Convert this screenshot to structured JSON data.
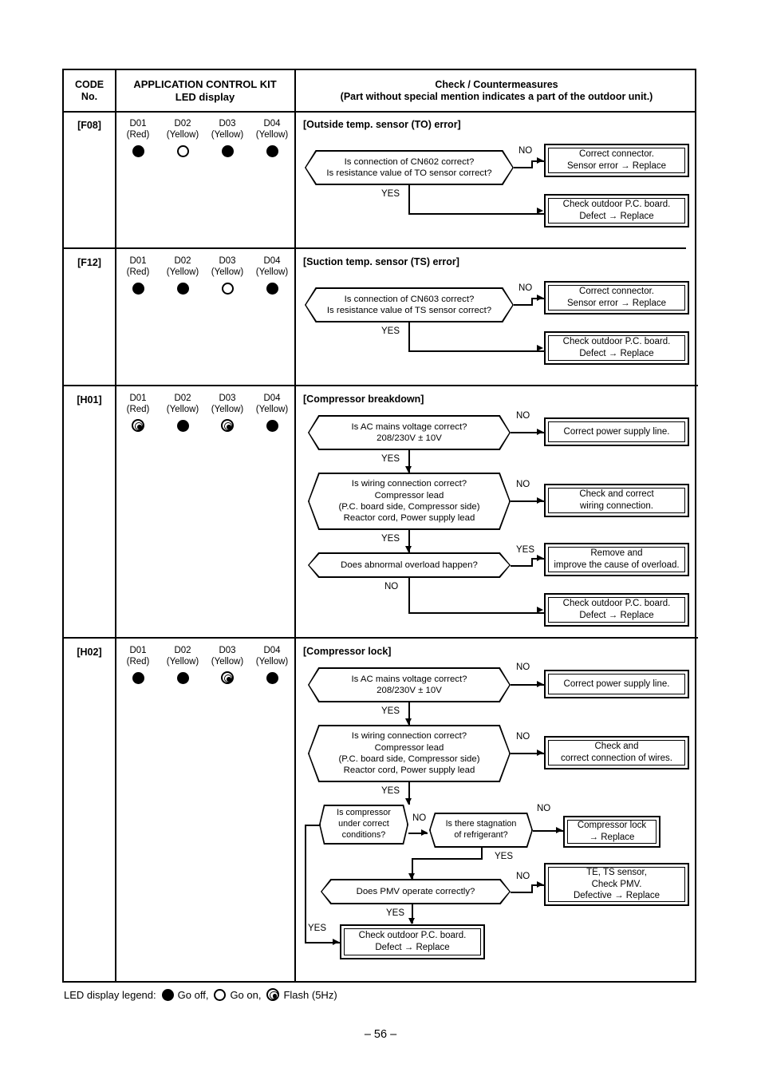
{
  "page": {
    "folio": "– 56 –",
    "legend": {
      "prefix": "LED display legend:",
      "off": "Go off,",
      "on": "Go on,",
      "flash": "Flash (5Hz)"
    }
  },
  "table": {
    "header": {
      "code_line1": "CODE",
      "code_line2": "No.",
      "led_line1": "APPLICATION CONTROL KIT",
      "led_line2": "LED display",
      "check_line1": "Check / Countermeasures",
      "check_line2": "(Part without special mention indicates a part of the outdoor unit.)"
    },
    "rows": [
      {
        "code": "[F08]",
        "leds": [
          {
            "name": "D01",
            "color": "(Red)",
            "state": "off"
          },
          {
            "name": "D02",
            "color": "(Yellow)",
            "state": "on"
          },
          {
            "name": "D03",
            "color": "(Yellow)",
            "state": "off"
          },
          {
            "name": "D04",
            "color": "(Yellow)",
            "state": "off"
          }
        ],
        "title": "[Outside temp. sensor (TO) error]",
        "decisions": [
          {
            "line1": "Is connection of CN602 correct?",
            "line2": "Is resistance value of TO sensor correct?"
          }
        ],
        "results": [
          {
            "line1": "Correct connector.",
            "line2": "Sensor error → Replace"
          },
          {
            "line1": "Check outdoor P.C. board.",
            "line2": "Defect → Replace"
          }
        ],
        "labels": {
          "no": "NO",
          "yes": "YES"
        }
      },
      {
        "code": "[F12]",
        "leds": [
          {
            "name": "D01",
            "color": "(Red)",
            "state": "off"
          },
          {
            "name": "D02",
            "color": "(Yellow)",
            "state": "off"
          },
          {
            "name": "D03",
            "color": "(Yellow)",
            "state": "on"
          },
          {
            "name": "D04",
            "color": "(Yellow)",
            "state": "off"
          }
        ],
        "title": "[Suction temp. sensor (TS) error]",
        "decisions": [
          {
            "line1": "Is connection of CN603 correct?",
            "line2": "Is resistance value of TS sensor correct?"
          }
        ],
        "results": [
          {
            "line1": "Correct connector.",
            "line2": "Sensor error → Replace"
          },
          {
            "line1": "Check outdoor P.C. board.",
            "line2": "Defect → Replace"
          }
        ],
        "labels": {
          "no": "NO",
          "yes": "YES"
        }
      },
      {
        "code": "[H01]",
        "leds": [
          {
            "name": "D01",
            "color": "(Red)",
            "state": "flash"
          },
          {
            "name": "D02",
            "color": "(Yellow)",
            "state": "off"
          },
          {
            "name": "D03",
            "color": "(Yellow)",
            "state": "flash"
          },
          {
            "name": "D04",
            "color": "(Yellow)",
            "state": "off"
          }
        ],
        "title": "[Compressor breakdown]",
        "decisions": [
          {
            "line1": "Is AC mains voltage correct?",
            "line2": "208/230V ± 10V"
          },
          {
            "line1": "Is wiring connection correct?",
            "line2": "Compressor lead",
            "line3": "(P.C. board side, Compressor side)",
            "line4": "Reactor cord, Power supply lead"
          },
          {
            "line1": "Does abnormal overload happen?"
          }
        ],
        "results": [
          {
            "line1": "Correct power supply line."
          },
          {
            "line1": "Check and correct",
            "line2": "wiring connection."
          },
          {
            "line1": "Remove and",
            "line2": "improve the cause of overload."
          },
          {
            "line1": "Check outdoor P.C. board.",
            "line2": "Defect → Replace"
          }
        ],
        "labels": {
          "no": "NO",
          "yes": "YES"
        }
      },
      {
        "code": "[H02]",
        "leds": [
          {
            "name": "D01",
            "color": "(Red)",
            "state": "off"
          },
          {
            "name": "D02",
            "color": "(Yellow)",
            "state": "off"
          },
          {
            "name": "D03",
            "color": "(Yellow)",
            "state": "flash"
          },
          {
            "name": "D04",
            "color": "(Yellow)",
            "state": "off"
          }
        ],
        "title": "[Compressor lock]",
        "decisions": [
          {
            "line1": "Is AC mains voltage correct?",
            "line2": "208/230V ± 10V"
          },
          {
            "line1": "Is wiring connection correct?",
            "line2": "Compressor lead",
            "line3": "(P.C. board side, Compressor side)",
            "line4": "Reactor cord, Power supply lead"
          },
          {
            "line1": "Is compressor",
            "line2": "under correct",
            "line3": "conditions?"
          },
          {
            "line1": "Is there stagnation",
            "line2": "of refrigerant?"
          },
          {
            "line1": "Does PMV operate correctly?"
          }
        ],
        "results": [
          {
            "line1": "Correct power supply line."
          },
          {
            "line1": "Check and",
            "line2": "correct connection of wires."
          },
          {
            "line1": "Compressor lock",
            "line2": "→ Replace"
          },
          {
            "line1": "TE, TS sensor,",
            "line2": "Check PMV.",
            "line3": "Defective → Replace"
          },
          {
            "line1": "Check outdoor P.C. board.",
            "line2": "Defect → Replace"
          }
        ],
        "labels": {
          "no": "NO",
          "yes": "YES"
        }
      }
    ]
  }
}
